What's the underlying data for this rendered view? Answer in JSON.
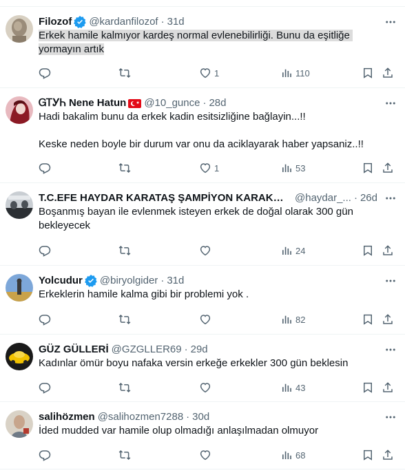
{
  "tweets": [
    {
      "name": "Filozof",
      "verified": true,
      "handle": "@kardanfilozof",
      "time": "31d",
      "text": "Erkek hamile kalmıyor kardeş normal evlenebilirliği. Bunu da eşitliğe yormayın artık",
      "likes": "1",
      "views": "110",
      "avatar_colors": [
        "#9a8c7a",
        "#d8d0c2"
      ]
    },
    {
      "name": "ᏀᎢᎩᏂ Nene Hatun",
      "flag": "turkey-flag-icon",
      "handle": "@10_gunce",
      "time": "28d",
      "text": "Hadi bakalim bunu da erkek kadin esitsizliğine bağlayin...!!\n\nKeske neden boyle bir durum var onu da aciklayarak haber yapsaniz..!!",
      "likes": "1",
      "views": "53",
      "avatar_colors": [
        "#8b1a24",
        "#e8b9bf"
      ]
    },
    {
      "name": "T.C.EFE HAYDAR KARATAŞ ŞAMPİYON KARAKARTAL",
      "handle": "@haydar_...",
      "time": "26d",
      "text": "Boşanmış bayan ile evlenmek isteyen erkek de doğal olarak 300 gün bekleyecek",
      "likes": "",
      "views": "24",
      "avatar_colors": [
        "#2b2f33",
        "#c9ced3"
      ]
    },
    {
      "name": "Yolcudur",
      "verified": true,
      "handle": "@biryolgider",
      "time": "31d",
      "text": "Erkeklerin hamile kalma gibi bir problemi yok .",
      "likes": "",
      "views": "82",
      "avatar_colors": [
        "#7da7d9",
        "#c9a24a"
      ]
    },
    {
      "name": "GÜZ GÜLLERİ",
      "handle": "@GZGLLER69",
      "time": "29d",
      "text": "Kadınlar ömür boyu nafaka versin erkeğe erkekler 300 gün beklesin",
      "likes": "",
      "views": "43",
      "avatar_colors": [
        "#1a1a1a",
        "#f2c200"
      ]
    },
    {
      "name": "salihözmen",
      "handle": "@salihozmen7288",
      "time": "30d",
      "text": "İded mudded var hamile olup olmadığı anlaşılmadan olmuyor",
      "likes": "",
      "views": "68",
      "avatar_colors": [
        "#6f7a86",
        "#d9d2c6"
      ]
    }
  ],
  "colors": {
    "accent": "#1d9bf0",
    "secondary_text": "#536471",
    "divider": "#eff3f4",
    "highlight": "#dcdcdc"
  }
}
